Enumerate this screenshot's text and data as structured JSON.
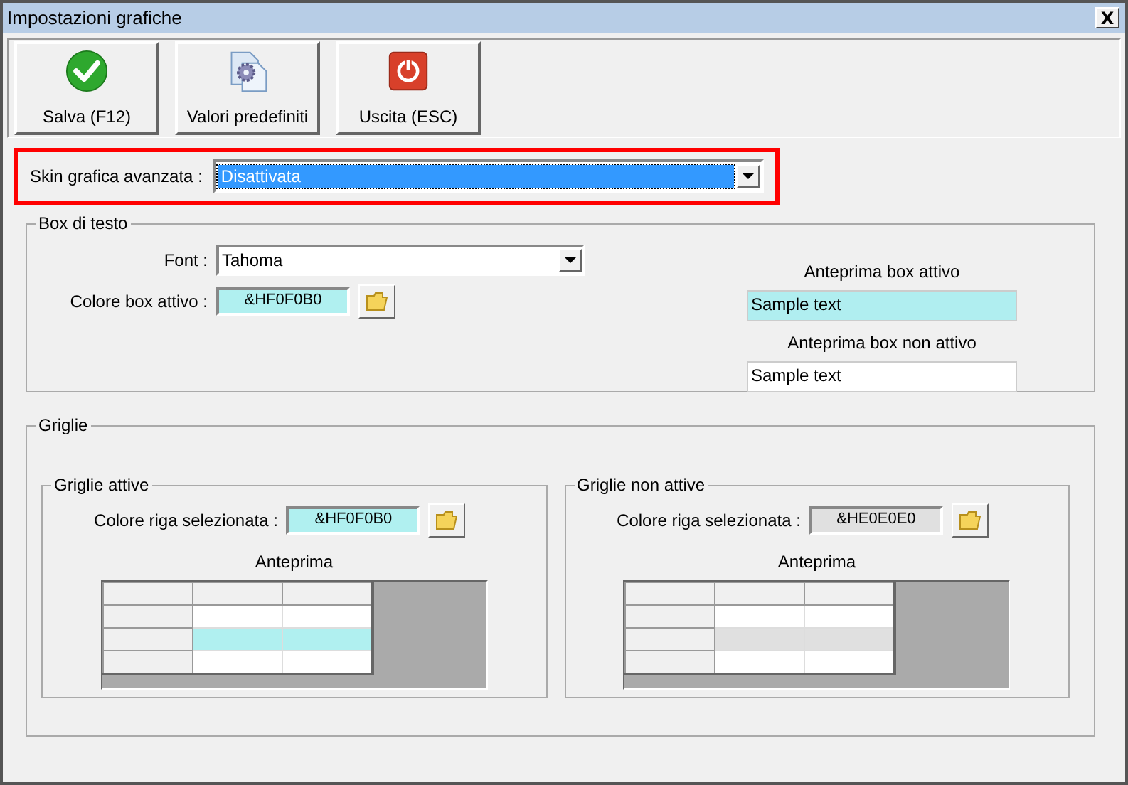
{
  "window": {
    "title": "Impostazioni grafiche",
    "close": "X"
  },
  "toolbar": [
    {
      "kind": "save",
      "label": "Salva (F12)"
    },
    {
      "kind": "defaults",
      "label": "Valori predefiniti"
    },
    {
      "kind": "exit",
      "label": "Uscita (ESC)"
    }
  ],
  "skin": {
    "label": "Skin grafica avanzata :",
    "value": "Disattivata"
  },
  "text_boxes": {
    "title": "Box di testo",
    "font_label": "Font :",
    "font_value": "Tahoma",
    "color_label": "Colore box attivo :",
    "color_value": "&HF0F0B0",
    "color": "#b0f0f0",
    "previews": [
      {
        "label": "Anteprima box attivo",
        "text": "Sample text",
        "active": true
      },
      {
        "label": "Anteprima box non attivo",
        "text": "Sample text",
        "active": false
      }
    ]
  },
  "grids": {
    "title": "Griglie",
    "groups": [
      {
        "title": "Griglie attive",
        "color_label": "Colore riga selezionata :",
        "color_value": "&HF0F0B0",
        "color": "#b0f0f0",
        "preview_label": "Anteprima",
        "rows": [
          {
            "selected": false
          },
          {
            "selected": true
          },
          {
            "selected": false
          }
        ]
      },
      {
        "title": "Griglie non attive",
        "color_label": "Colore riga selezionata :",
        "color_value": "&HE0E0E0",
        "color": "#e0e0e0",
        "preview_label": "Anteprima",
        "rows": [
          {
            "selected": false
          },
          {
            "selected": true
          },
          {
            "selected": false
          }
        ]
      }
    ]
  }
}
